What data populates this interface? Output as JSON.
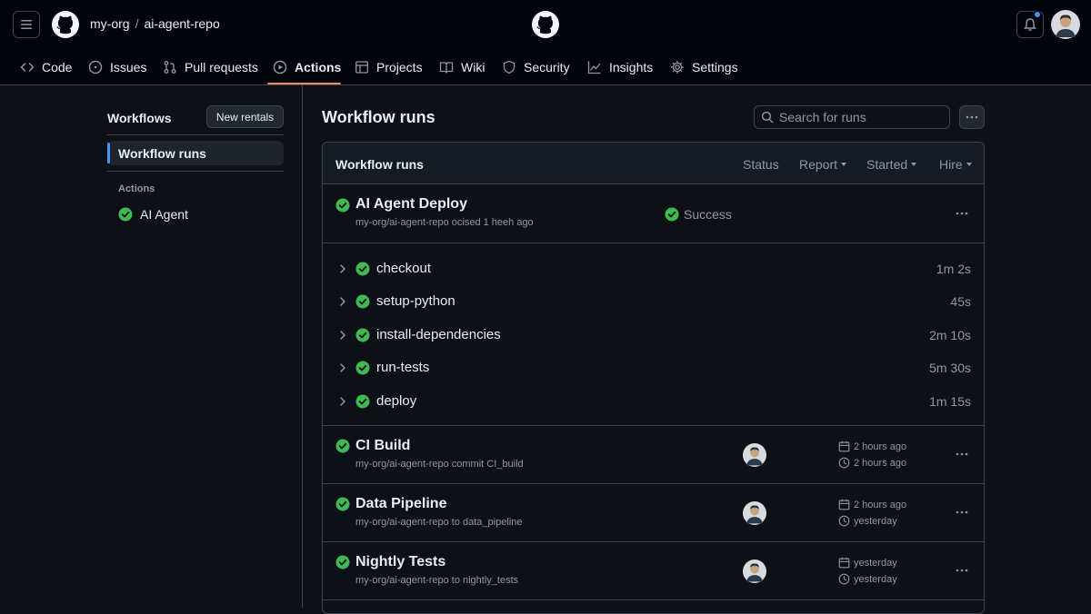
{
  "header": {
    "org": "my-org",
    "separator": "/",
    "repo": "ai-agent-repo"
  },
  "nav": [
    {
      "label": "Code",
      "icon": "code-icon"
    },
    {
      "label": "Issues",
      "icon": "issue-icon"
    },
    {
      "label": "Pull requests",
      "icon": "pull-request-icon"
    },
    {
      "label": "Actions",
      "icon": "play-icon",
      "active": true
    },
    {
      "label": "Projects",
      "icon": "table-icon"
    },
    {
      "label": "Wiki",
      "icon": "book-icon"
    },
    {
      "label": "Security",
      "icon": "shield-icon"
    },
    {
      "label": "Insights",
      "icon": "graph-icon"
    },
    {
      "label": "Settings",
      "icon": "gear-icon"
    }
  ],
  "sidebar": {
    "title": "Workflows",
    "new_button": "New rentals",
    "active_item": "Workflow runs",
    "section_label": "Actions",
    "workflows": [
      {
        "label": "AI Agent"
      }
    ]
  },
  "main": {
    "title": "Workflow runs",
    "search_placeholder": "Search for runs",
    "table_title": "Workflow runs",
    "filters": {
      "status": "Status",
      "report": "Report",
      "started": "Started",
      "hire": "Hire"
    }
  },
  "runs": [
    {
      "title": "AI Agent Deploy",
      "subtitle": "my-org/ai-agent-repo ocised 1 heeh ago",
      "status": "Success",
      "jobs": [
        {
          "name": "checkout",
          "duration": "1m 2s"
        },
        {
          "name": "setup-python",
          "duration": "45s"
        },
        {
          "name": "install-dependencies",
          "duration": "2m 10s"
        },
        {
          "name": "run-tests",
          "duration": "5m 30s"
        },
        {
          "name": "deploy",
          "duration": "1m 15s"
        }
      ]
    },
    {
      "title": "CI Build",
      "subtitle": "my-org/ai-agent-repo commit CI_build",
      "started": "2 hours ago",
      "duration": "2 hours ago"
    },
    {
      "title": "Data Pipeline",
      "subtitle": "my-org/ai-agent-repo to data_pipeline",
      "started": "2 hours ago",
      "duration": "yesterday"
    },
    {
      "title": "Nightly Tests",
      "subtitle": "my-org/ai-agent-repo to nightly_tests",
      "started": "yesterday",
      "duration": "yesterday"
    }
  ],
  "colors": {
    "success": "#3fb950",
    "accent": "#4493f8",
    "underline": "#f78166"
  }
}
